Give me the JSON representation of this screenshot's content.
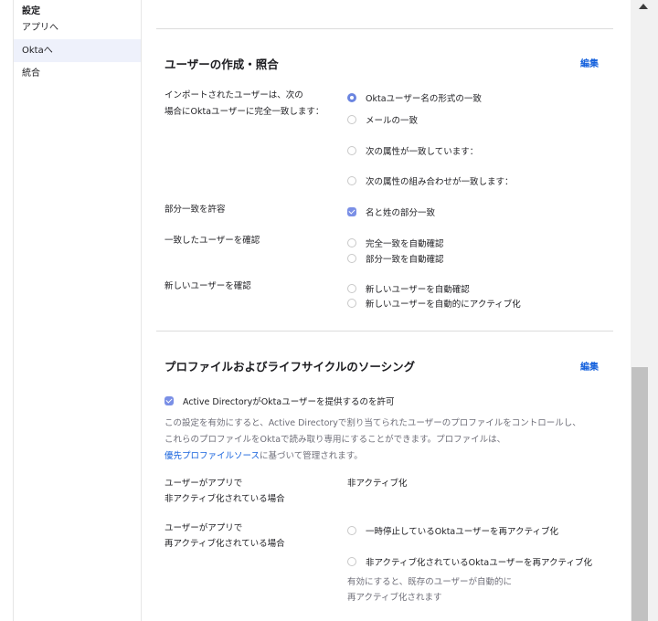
{
  "sidebar": {
    "heading": "設定",
    "items": [
      {
        "label": "アプリへ"
      },
      {
        "label": "Oktaへ"
      },
      {
        "label": "統合"
      }
    ]
  },
  "section1": {
    "title": "ユーザーの作成・照合",
    "edit_label": "編集",
    "import_label_line1": "インポートされたユーザーは、次の",
    "import_label_line2": "場合にOktaユーザーに完全一致します：",
    "import_options": [
      "Oktaユーザー名の形式の一致",
      "メールの一致",
      "次の属性が一致しています：",
      "次の属性の組み合わせが一致します："
    ],
    "partial_label": "部分一致を許容",
    "partial_option": "名と姓の部分一致",
    "confirm_label": "一致したユーザーを確認",
    "confirm_options": [
      "完全一致を自動確認",
      "部分一致を自動確認"
    ],
    "new_label": "新しいユーザーを確認",
    "new_options": [
      "新しいユーザーを自動確認",
      "新しいユーザーを自動的にアクティブ化"
    ]
  },
  "section2": {
    "title": "プロファイルおよびライフサイクルのソーシング",
    "edit_label": "編集",
    "allow_label": "Active DirectoryがOktaユーザーを提供するのを許可",
    "desc_line1": "この設定を有効にすると、Active Directoryで割り当てられたユーザーのプロファイルをコントロールし、",
    "desc_line2": "これらのプロファイルをOktaで読み取り専用にすることができます。プロファイルは、",
    "desc_link": "優先プロファイルソース",
    "desc_line3_tail": "に基づいて管理されます。",
    "deact_label_line1": "ユーザーがアプリで",
    "deact_label_line2": "非アクティブ化されている場合",
    "deact_value": "非アクティブ化",
    "react_label_line1": "ユーザーがアプリで",
    "react_label_line2": "再アクティブ化されている場合",
    "react_options": [
      "一時停止しているOktaユーザーを再アクティブ化",
      "非アクティブ化されているOktaユーザーを再アクティブ化"
    ],
    "react_note_line1": "有効にすると、既存のユーザーが自動的に",
    "react_note_line2": "再アクティブ化されます"
  }
}
